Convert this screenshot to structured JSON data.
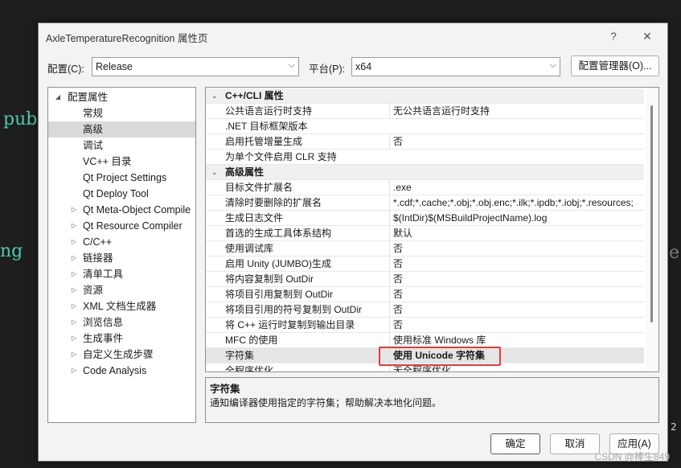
{
  "background": {
    "left_text_1": "pub",
    "left_text_2": "ng",
    "right_text": "e",
    "right_num": "2"
  },
  "dialog": {
    "title": "AxleTemperatureRecognition 属性页",
    "help_label": "?",
    "close_label": "✕"
  },
  "toolbar": {
    "config_label": "配置(C):",
    "config_value": "Release",
    "platform_label": "平台(P):",
    "platform_value": "x64",
    "manager_button": "配置管理器(O)..."
  },
  "tree": {
    "root": "配置属性",
    "items": [
      {
        "label": "常规",
        "expandable": false
      },
      {
        "label": "高级",
        "expandable": false,
        "selected": true
      },
      {
        "label": "调试",
        "expandable": false
      },
      {
        "label": "VC++ 目录",
        "expandable": false
      },
      {
        "label": "Qt Project Settings",
        "expandable": false
      },
      {
        "label": "Qt Deploy Tool",
        "expandable": false
      },
      {
        "label": "Qt Meta-Object Compile",
        "expandable": true
      },
      {
        "label": "Qt Resource Compiler",
        "expandable": true
      },
      {
        "label": "C/C++",
        "expandable": true
      },
      {
        "label": "链接器",
        "expandable": true
      },
      {
        "label": "清单工具",
        "expandable": true
      },
      {
        "label": "资源",
        "expandable": true
      },
      {
        "label": "XML 文档生成器",
        "expandable": true
      },
      {
        "label": "浏览信息",
        "expandable": true
      },
      {
        "label": "生成事件",
        "expandable": true
      },
      {
        "label": "自定义生成步骤",
        "expandable": true
      },
      {
        "label": "Code Analysis",
        "expandable": true
      }
    ]
  },
  "grid": {
    "rows": [
      {
        "type": "cat",
        "key": "C++/CLI 属性",
        "value": ""
      },
      {
        "type": "prop",
        "key": "公共语言运行时支持",
        "value": "无公共语言运行时支持"
      },
      {
        "type": "prop",
        "key": ".NET 目标框架版本",
        "value": ""
      },
      {
        "type": "prop",
        "key": "启用托管增量生成",
        "value": "否"
      },
      {
        "type": "prop",
        "key": "为单个文件启用 CLR 支持",
        "value": ""
      },
      {
        "type": "cat",
        "key": "高级属性",
        "value": ""
      },
      {
        "type": "prop",
        "key": "目标文件扩展名",
        "value": ".exe"
      },
      {
        "type": "prop",
        "key": "清除时要删除的扩展名",
        "value": "*.cdf;*.cache;*.obj;*.obj.enc;*.ilk;*.ipdb;*.iobj;*.resources;"
      },
      {
        "type": "prop",
        "key": "生成日志文件",
        "value": "$(IntDir)$(MSBuildProjectName).log"
      },
      {
        "type": "prop",
        "key": "首选的生成工具体系结构",
        "value": "默认"
      },
      {
        "type": "prop",
        "key": "使用调试库",
        "value": "否"
      },
      {
        "type": "prop",
        "key": "启用 Unity (JUMBO)生成",
        "value": "否"
      },
      {
        "type": "prop",
        "key": "将内容复制到 OutDir",
        "value": "否"
      },
      {
        "type": "prop",
        "key": "将项目引用复制到 OutDir",
        "value": "否"
      },
      {
        "type": "prop",
        "key": "将项目引用的符号复制到 OutDir",
        "value": "否"
      },
      {
        "type": "prop",
        "key": "将 C++ 运行时复制到输出目录",
        "value": "否"
      },
      {
        "type": "prop",
        "key": "MFC 的使用",
        "value": "使用标准 Windows 库"
      },
      {
        "type": "sel",
        "key": "字符集",
        "value": "使用 Unicode 字符集"
      },
      {
        "type": "prop",
        "key": "全程序优化",
        "value": "无全程序优化"
      }
    ]
  },
  "description": {
    "title": "字符集",
    "text": "通知编译器使用指定的字符集；帮助解决本地化问题。"
  },
  "buttons": {
    "ok": "确定",
    "cancel": "取消",
    "apply": "应用(A)"
  },
  "watermark": "CSDN @棒生849"
}
